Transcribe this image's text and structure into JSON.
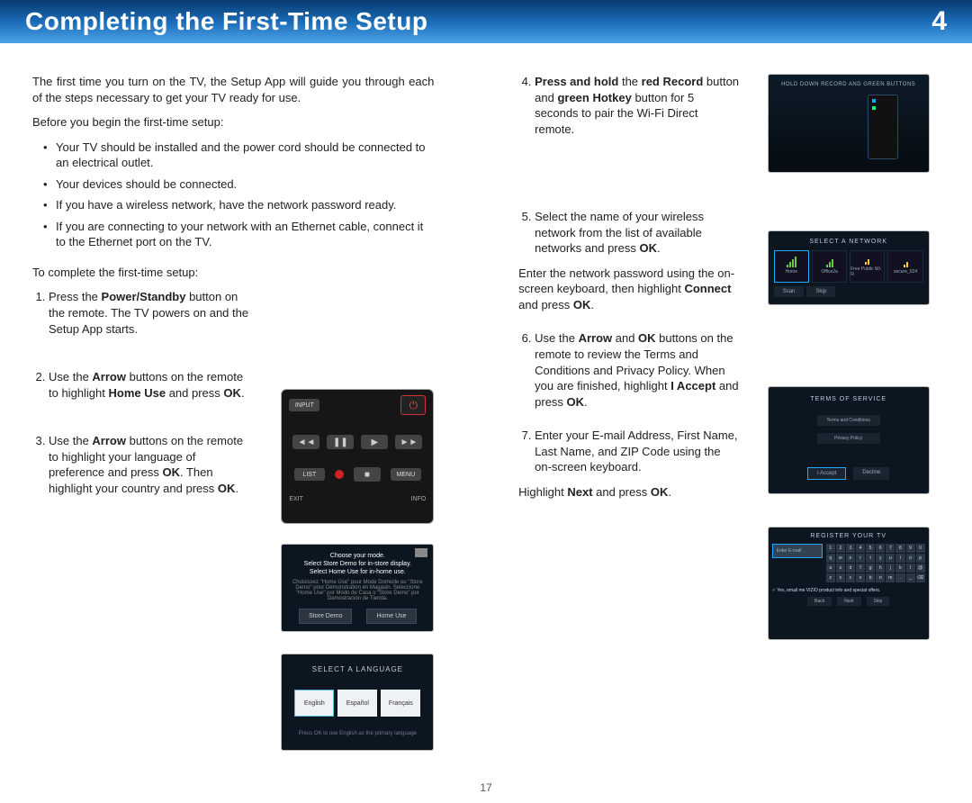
{
  "header": {
    "title": "Completing the First-Time Setup",
    "chapter": "4"
  },
  "page_number": "17",
  "intro": "The first time you turn on the TV, the Setup App will guide you through each of the steps necessary to get your TV ready for use.",
  "before_label": "Before you begin the first-time setup:",
  "before": [
    "Your TV should be installed and the power cord should be connected to an electrical outlet.",
    "Your devices should be connected.",
    "If you have a wireless network, have the network password ready.",
    "If you are connecting to your network with an Ethernet cable, connect it to the Ethernet port on the TV."
  ],
  "complete_label": "To complete the first-time setup:",
  "steps": {
    "s1": {
      "pre": "Press the ",
      "bold1": "Power/Standby",
      "post": " button on the remote. The TV powers on and the Setup App starts."
    },
    "s2": {
      "t1": "Use the ",
      "b1": "Arrow",
      "t2": " buttons on the remote to highlight ",
      "b2": "Home Use",
      "t3": " and press ",
      "b3": "OK",
      "t4": "."
    },
    "s3": {
      "t1": "Use the ",
      "b1": "Arrow",
      "t2": " buttons on the remote to highlight your language of preference and press ",
      "b2": "OK",
      "t3": ". Then highlight your country and press ",
      "b3": "OK",
      "t4": "."
    },
    "s4": {
      "b1": "Press and hold",
      "t1": " the ",
      "b2": "red Record",
      "t2": " button and ",
      "b3": "green Hotkey",
      "t3": " button for 5 seconds to pair the Wi-Fi Direct remote."
    },
    "s5": {
      "t1": "Select the name of your wireless network from the list of available networks and press ",
      "b1": "OK",
      "t2": ".",
      "p2a": "Enter the network password using the on-screen keyboard, then highlight ",
      "p2b": "Connect",
      "p2c": " and press ",
      "p2d": "OK",
      "p2e": "."
    },
    "s6": {
      "t1": "Use the ",
      "b1": "Arrow",
      "t2": " and ",
      "b2": "OK",
      "t3": " buttons on the remote to review the Terms and Conditions and Privacy Policy. When you are finished, highlight ",
      "b3": "I Accept",
      "t4": " and press ",
      "b4": "OK",
      "t5": "."
    },
    "s7": {
      "t1": "Enter your E-mail Address, First Name, Last Name, and ZIP Code using the on-screen keyboard.",
      "p2a": "Highlight ",
      "p2b": "Next",
      "p2c": " and press ",
      "p2d": "OK",
      "p2e": "."
    }
  },
  "thumbs": {
    "remote": {
      "input": "INPUT",
      "list": "LIST",
      "menu": "MENU",
      "exit": "EXIT",
      "info": "INFO"
    },
    "mode": {
      "l1": "Choose your mode.",
      "l2": "Select Store Demo for in-store display.",
      "l3": "Select Home Use for in-home use.",
      "sub": "Choisissez \"Home Use\" pour Mode Domicile ou \"Store Demo\" pour Démonstration en Magasin. Seleccione \"Home Use\" por Modo de Casa o \"Store Demo\" por Demostración de Tienda.",
      "b1": "Store Demo",
      "b2": "Home Use"
    },
    "lang": {
      "title": "SELECT A LANGUAGE",
      "o1": "English",
      "o2": "Español",
      "o3": "Français",
      "foot": "Press OK to use English as the primary language"
    },
    "pair": {
      "title": "HOLD DOWN RECORD AND GREEN BUTTONS"
    },
    "net": {
      "title": "SELECT A NETWORK",
      "n1": "Home",
      "n2": "Office2a",
      "n3": "Free Public Wi-Fi",
      "n4": "secure_024",
      "btn1": "Scan",
      "btn2": "Skip"
    },
    "terms": {
      "title": "TERMS OF SERVICE",
      "l1": "Terms and Conditions",
      "l2": "Privacy Policy",
      "b1": "I Accept",
      "b2": "Decline"
    },
    "reg": {
      "title": "REGISTER YOUR TV",
      "field": "Enter E-mail",
      "chk": "Yes, email me VIZIO product info and special offers.",
      "b1": "Back",
      "b2": "Next",
      "b3": "Skip"
    }
  }
}
